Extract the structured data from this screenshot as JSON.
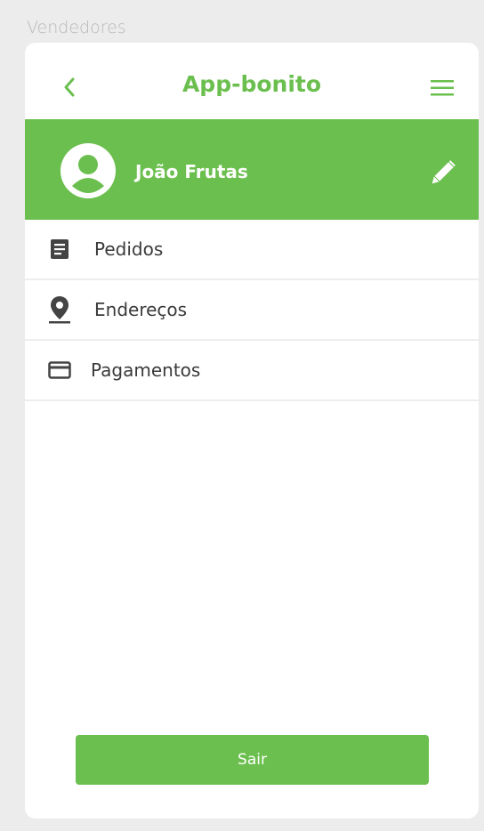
{
  "canvas": {
    "label": "Vendedores"
  },
  "appbar": {
    "title": "App-bonito",
    "back_icon": "chevron-left-icon",
    "menu_icon": "hamburger-menu-icon"
  },
  "profile": {
    "name": "João Frutas",
    "avatar_icon": "account-circle-icon",
    "edit_icon": "pencil-icon"
  },
  "menu": {
    "items": [
      {
        "label": "Pedidos",
        "icon": "document-list-icon"
      },
      {
        "label": "Endereços",
        "icon": "location-pin-icon"
      },
      {
        "label": "Pagamentos",
        "icon": "credit-card-icon"
      }
    ]
  },
  "actions": {
    "logout_label": "Sair"
  },
  "colors": {
    "accent": "#6bbf4e",
    "text": "#3a3a3a",
    "background": "#ececec"
  }
}
